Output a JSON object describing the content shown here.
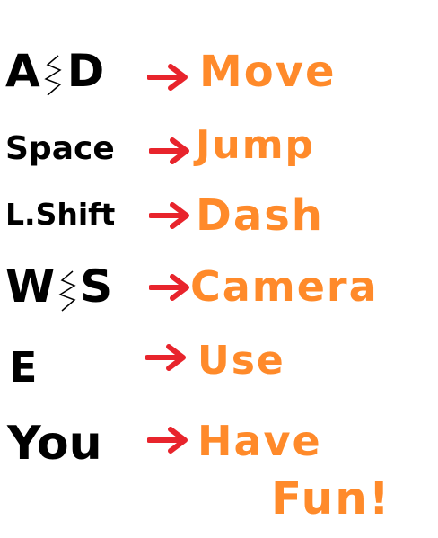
{
  "colors": {
    "background": "#ffffff",
    "key_text": "#000000",
    "arrow": "#e8242c",
    "action_text": "#ff8a2a"
  },
  "controls": [
    {
      "key_parts": [
        "A",
        "D"
      ],
      "separator_icon": "ampersand-scribble-icon",
      "action": "Move"
    },
    {
      "key": "Space",
      "action": "Jump"
    },
    {
      "key": "L.Shift",
      "action": "Dash"
    },
    {
      "key_parts": [
        "W",
        "S"
      ],
      "separator_icon": "ampersand-scribble-icon",
      "action": "Camera"
    },
    {
      "key": "E",
      "action": "Use"
    },
    {
      "key": "You",
      "action": "Have"
    }
  ],
  "closing_text": "Fun!",
  "arrow_icon": "right-arrow-icon"
}
